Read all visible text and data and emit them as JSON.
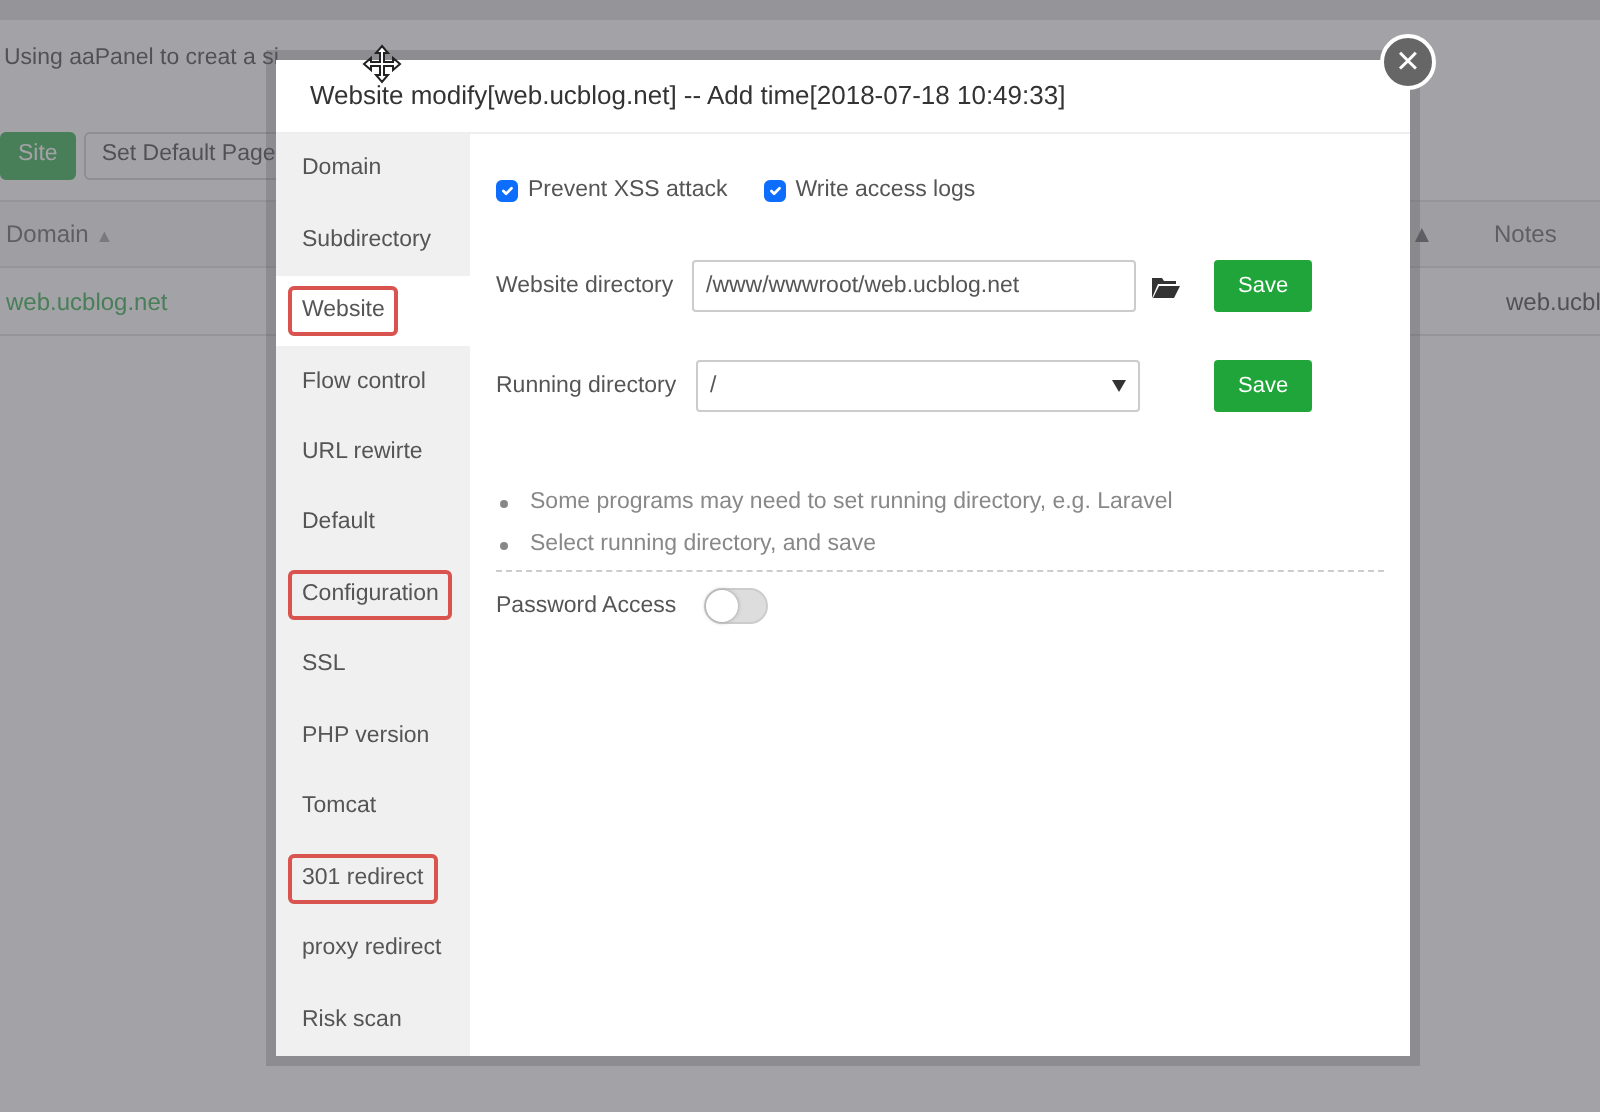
{
  "page": {
    "notice": "Using aaPanel to creat a si",
    "buttons": [
      {
        "label": "Site",
        "kind": "primary"
      },
      {
        "label": "Set Default Page",
        "kind": "plain"
      }
    ],
    "table": {
      "columns": [
        {
          "label": "Domain",
          "sort": "▲"
        },
        {
          "label": "▲"
        },
        {
          "label": "Notes"
        }
      ],
      "rows": [
        {
          "domain": "web.ucblog.net",
          "notes": "web.ucbl"
        }
      ]
    }
  },
  "modal": {
    "title": "Website modify[web.ucblog.net] -- Add time[2018-07-18 10:49:33]",
    "close": "×",
    "sidebar": [
      {
        "label": "Domain",
        "selected": false,
        "highlighted": false
      },
      {
        "label": "Subdirectory",
        "selected": false,
        "highlighted": false
      },
      {
        "label": "Website",
        "selected": true,
        "highlighted": true
      },
      {
        "label": "Flow control",
        "selected": false,
        "highlighted": false
      },
      {
        "label": "URL rewirte",
        "selected": false,
        "highlighted": false
      },
      {
        "label": "Default",
        "selected": false,
        "highlighted": false
      },
      {
        "label": "Configuration",
        "selected": false,
        "highlighted": true
      },
      {
        "label": "SSL",
        "selected": false,
        "highlighted": false
      },
      {
        "label": "PHP version",
        "selected": false,
        "highlighted": false
      },
      {
        "label": "Tomcat",
        "selected": false,
        "highlighted": false
      },
      {
        "label": "301 redirect",
        "selected": false,
        "highlighted": true
      },
      {
        "label": "proxy redirect",
        "selected": false,
        "highlighted": false
      },
      {
        "label": "Risk scan",
        "selected": false,
        "highlighted": false
      }
    ],
    "options": [
      {
        "label": "Prevent XSS attack",
        "checked": true
      },
      {
        "label": "Write access logs",
        "checked": true
      }
    ],
    "fields": [
      {
        "label": "Website directory",
        "kind": "input",
        "value": "/www/wwwroot/web.ucblog.net",
        "button": "Save"
      },
      {
        "label": "Running directory",
        "kind": "select",
        "value": "/",
        "button": "Save"
      }
    ],
    "tips": [
      "Some programs may need to set running directory, e.g. Laravel",
      "Select running directory, and save"
    ],
    "password_access": {
      "label": "Password Access",
      "on": false
    }
  }
}
